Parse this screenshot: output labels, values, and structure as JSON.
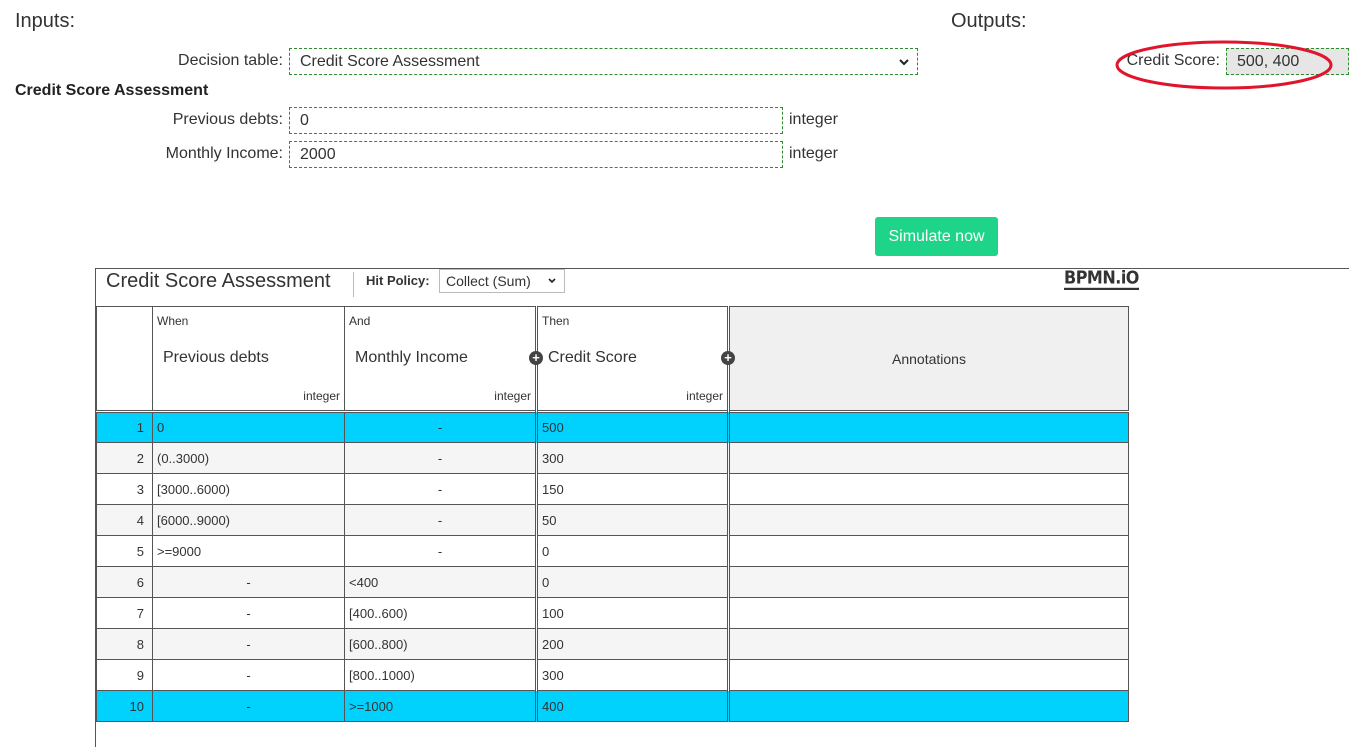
{
  "inputs": {
    "section_label": "Inputs:",
    "decision_table_label": "Decision table:",
    "decision_table_value": "Credit Score Assessment",
    "subtitle": "Credit Score Assessment",
    "fields": [
      {
        "label": "Previous debts:",
        "value": "0",
        "type": "integer"
      },
      {
        "label": "Monthly Income:",
        "value": "2000",
        "type": "integer"
      }
    ]
  },
  "outputs": {
    "section_label": "Outputs:",
    "credit_score_label": "Credit Score:",
    "credit_score_value": "500, 400",
    "highlight_color": "#e0152b"
  },
  "simulate_button": {
    "label": "Simulate now",
    "color": "#1ed488"
  },
  "dmn": {
    "title": "Credit Score Assessment",
    "hit_policy_label": "Hit Policy:",
    "hit_policy_value": "Collect (Sum)",
    "logo": "BPMN.iO",
    "columns": [
      {
        "kind": "When",
        "name": "Previous debts",
        "type": "integer"
      },
      {
        "kind": "And",
        "name": "Monthly Income",
        "type": "integer"
      },
      {
        "kind": "Then",
        "name": "Credit Score",
        "type": "integer"
      }
    ],
    "annotations_label": "Annotations",
    "highlight_color": "#00d2fd",
    "rows": [
      {
        "num": "1",
        "debts": "0",
        "income": "-",
        "score": "500",
        "highlight": true
      },
      {
        "num": "2",
        "debts": "(0..3000)",
        "income": "-",
        "score": "300",
        "highlight": false
      },
      {
        "num": "3",
        "debts": "[3000..6000)",
        "income": "-",
        "score": "150",
        "highlight": false
      },
      {
        "num": "4",
        "debts": "[6000..9000)",
        "income": "-",
        "score": "50",
        "highlight": false
      },
      {
        "num": "5",
        "debts": ">=9000",
        "income": "-",
        "score": "0",
        "highlight": false
      },
      {
        "num": "6",
        "debts": "-",
        "income": "<400",
        "score": "0",
        "highlight": false
      },
      {
        "num": "7",
        "debts": "-",
        "income": "[400..600)",
        "score": "100",
        "highlight": false
      },
      {
        "num": "8",
        "debts": "-",
        "income": "[600..800)",
        "score": "200",
        "highlight": false
      },
      {
        "num": "9",
        "debts": "-",
        "income": "[800..1000)",
        "score": "300",
        "highlight": false
      },
      {
        "num": "10",
        "debts": "-",
        "income": ">=1000",
        "score": "400",
        "highlight": true
      }
    ]
  }
}
